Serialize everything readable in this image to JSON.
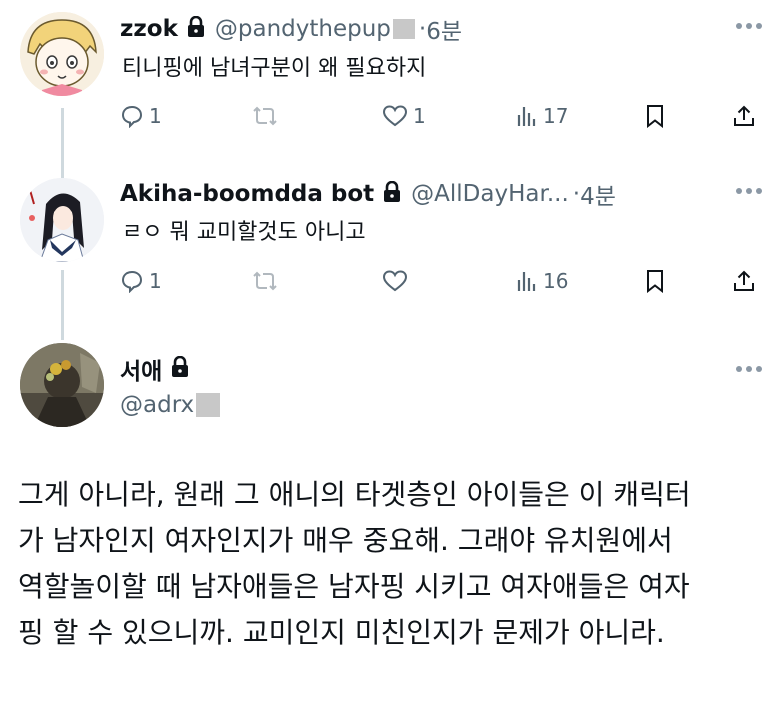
{
  "tweets": [
    {
      "name": "zzok",
      "handle": "@pandythepup",
      "dot": "·",
      "time": "6분",
      "text": "티니핑에 남녀구분이 왜 필요하지",
      "replies": "1",
      "retweets": "",
      "likes": "1",
      "views": "17"
    },
    {
      "name": "Akiha-boomdda bot",
      "handle": "@AllDayHar...",
      "dot": "·",
      "time": "4분",
      "text": "ㄹㅇ 뭐 교미할것도 아니고",
      "replies": "1",
      "retweets": "",
      "likes": "",
      "views": "16"
    }
  ],
  "main_post": {
    "name": "서애",
    "handle": "@adrx",
    "lines": [
      "그게 아니라, 원래 그 애니의 타겟층인 아이들은 이 캐릭터",
      "가 남자인지 여자인지가 매우 중요해. 그래야 유치원에서",
      "역할놀이할 때 남자애들은 남자핑 시키고 여자애들은 여자",
      "핑 할 수 있으니까. 교미인지 미친인지가 문제가 아니라."
    ]
  },
  "icons": [
    "lock-icon",
    "more-icon",
    "reply-icon",
    "retweet-icon",
    "like-icon",
    "views-icon",
    "bookmark-icon",
    "share-icon"
  ],
  "colors": {
    "secondary_text": "#536471",
    "thread_line": "#cfd9de",
    "redaction": "#c8c8c8"
  }
}
